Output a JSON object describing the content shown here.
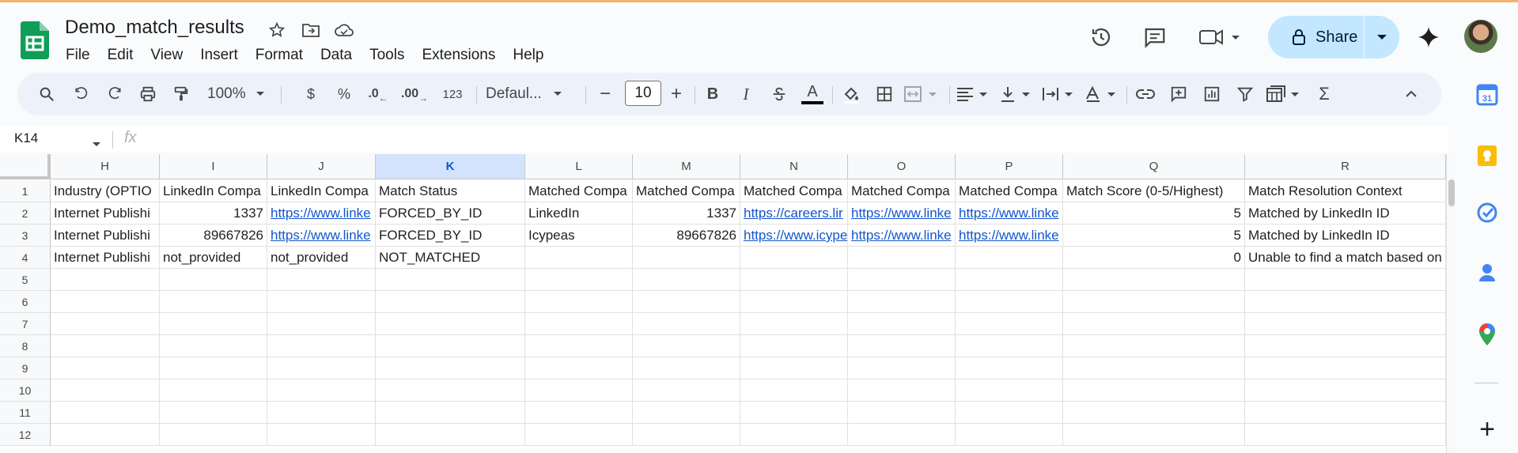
{
  "document": {
    "title": "Demo_match_results"
  },
  "menu": [
    "File",
    "Edit",
    "View",
    "Insert",
    "Format",
    "Data",
    "Tools",
    "Extensions",
    "Help"
  ],
  "share": {
    "label": "Share"
  },
  "toolbar": {
    "zoom": "100%",
    "currency": "$",
    "percent": "%",
    "decrease_decimal": ".0",
    "increase_decimal": ".00",
    "number_format": "123",
    "font": "Defaul...",
    "font_size": "10",
    "minus": "−",
    "plus": "+",
    "bold": "B",
    "italic": "I"
  },
  "formula_bar": {
    "cell_ref": "K14",
    "fx": "fx"
  },
  "grid": {
    "columns": [
      "H",
      "I",
      "J",
      "K",
      "L",
      "M",
      "N",
      "O",
      "P",
      "Q",
      "R"
    ],
    "selected_column": "K",
    "rows": [
      "1",
      "2",
      "3",
      "4",
      "5",
      "6",
      "7",
      "8",
      "9",
      "10",
      "11",
      "12"
    ],
    "cells": {
      "r1": [
        "Industry (OPTIO",
        "LinkedIn Compa",
        "LinkedIn Compa",
        "Match Status",
        "Matched Compa",
        "Matched Compa",
        "Matched Compa",
        "Matched Compa",
        "Matched Compa",
        "Match Score (0-5/Highest)",
        "Match Resolution Context"
      ],
      "r2": [
        "Internet Publishi",
        "1337",
        "https://www.linke",
        "FORCED_BY_ID",
        "LinkedIn",
        "1337",
        "https://careers.lir",
        "https://www.linke",
        "https://www.linke",
        "5",
        "Matched by LinkedIn ID"
      ],
      "r3": [
        "Internet Publishi",
        "89667826",
        "https://www.linke",
        "FORCED_BY_ID",
        "Icypeas",
        "89667826",
        "https://www.icype",
        "https://www.linke",
        "https://www.linke",
        "5",
        "Matched by LinkedIn ID"
      ],
      "r4": [
        "Internet Publishi",
        "not_provided",
        "not_provided",
        "NOT_MATCHED",
        "",
        "",
        "",
        "",
        "",
        "0",
        "Unable to find a match based on"
      ]
    }
  },
  "icons": {
    "history": "history-icon",
    "comments": "comment-icon",
    "meet": "video-camera-icon",
    "gemini": "gemini-sparkle-icon"
  },
  "colors": {
    "accent": "#0b57d0",
    "share_bg": "#c2e7ff",
    "link": "#1155cc",
    "sheets_green": "#0f9d58"
  }
}
